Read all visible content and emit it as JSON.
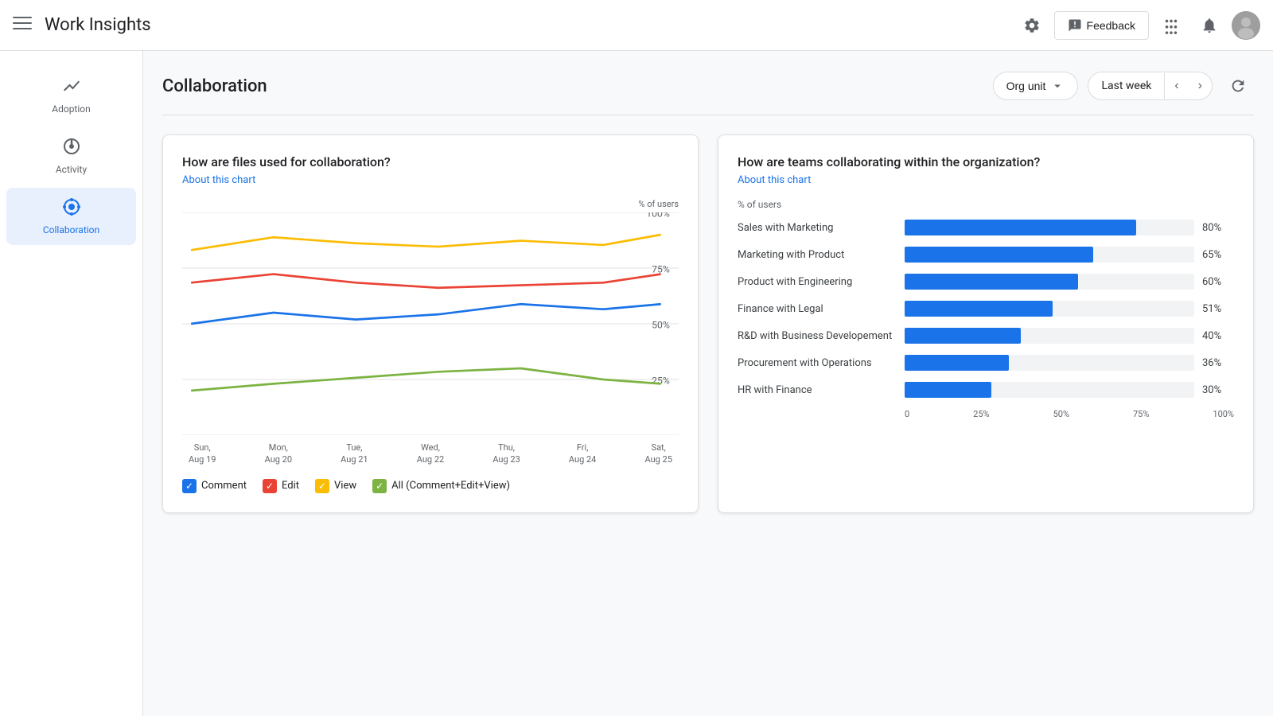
{
  "header": {
    "menu_icon": "☰",
    "title": "Work Insights",
    "feedback_icon": "💬",
    "feedback_label": "Feedback",
    "grid_icon": "⊞",
    "bell_icon": "🔔",
    "settings_icon": "⚙"
  },
  "sidebar": {
    "items": [
      {
        "id": "adoption",
        "label": "Adoption",
        "icon": "↗",
        "active": false
      },
      {
        "id": "activity",
        "label": "Activity",
        "icon": "◎",
        "active": false
      },
      {
        "id": "collaboration",
        "label": "Collaboration",
        "icon": "⊕",
        "active": true
      }
    ]
  },
  "page": {
    "title": "Collaboration",
    "org_unit_label": "Org unit",
    "week_label": "Last week",
    "refresh_icon": "↻"
  },
  "left_card": {
    "title": "How are files used for collaboration?",
    "about_label": "About this chart",
    "y_label": "% of users",
    "x_labels": [
      {
        "line1": "Sun,",
        "line2": "Aug 19"
      },
      {
        "line1": "Mon,",
        "line2": "Aug 20"
      },
      {
        "line1": "Tue,",
        "line2": "Aug 21"
      },
      {
        "line1": "Wed,",
        "line2": "Aug 22"
      },
      {
        "line1": "Thu,",
        "line2": "Aug 23"
      },
      {
        "line1": "Fri,",
        "line2": "Aug 24"
      },
      {
        "line1": "Sat,",
        "line2": "Aug 25"
      }
    ],
    "legend": [
      {
        "label": "Comment",
        "color": "#1a73e8"
      },
      {
        "label": "Edit",
        "color": "#ea4335"
      },
      {
        "label": "View",
        "color": "#fbbc04"
      },
      {
        "label": "All (Comment+Edit+View)",
        "color": "#7cb342"
      }
    ],
    "series": {
      "comment": [
        43,
        52,
        46,
        50,
        58,
        54,
        58
      ],
      "edit": [
        68,
        72,
        68,
        65,
        66,
        68,
        72
      ],
      "view": [
        80,
        85,
        82,
        80,
        83,
        81,
        84
      ],
      "all": [
        20,
        22,
        24,
        26,
        28,
        25,
        22
      ]
    }
  },
  "right_card": {
    "title": "How are teams collaborating within the organization?",
    "about_label": "About this chart",
    "y_label": "% of users",
    "bars": [
      {
        "label": "Sales with Marketing",
        "pct": 80
      },
      {
        "label": "Marketing with Product",
        "pct": 65
      },
      {
        "label": "Product with Engineering",
        "pct": 60
      },
      {
        "label": "Finance with Legal",
        "pct": 51
      },
      {
        "label": "R&D with Business Developement",
        "pct": 40
      },
      {
        "label": "Procurement with Operations",
        "pct": 36
      },
      {
        "label": "HR with Finance",
        "pct": 30
      }
    ],
    "x_axis_labels": [
      "0",
      "25%",
      "50%",
      "75%",
      "100%"
    ]
  }
}
